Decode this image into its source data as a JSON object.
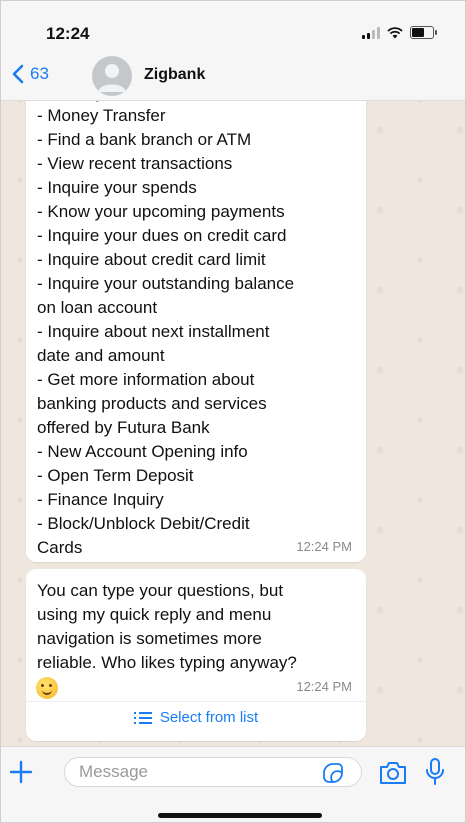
{
  "status_bar": {
    "time": "12:24"
  },
  "header": {
    "back_count": "63",
    "contact_name": "Zigbank"
  },
  "messages": [
    {
      "partial_top_line": "- Bill Payments",
      "lines": [
        "- Money Transfer",
        "- Find a bank branch or ATM",
        "- View recent transactions",
        "- Inquire your spends",
        "- Know your upcoming payments",
        "- Inquire your dues on credit card",
        "- Inquire about credit card limit",
        "- Inquire your outstanding balance",
        "on loan account",
        "- Inquire about next installment",
        "date and amount",
        "- Get more information about",
        "banking products and services",
        "offered by Futura Bank",
        "- New Account Opening info",
        "- Open Term Deposit",
        "- Finance Inquiry",
        "- Block/Unblock Debit/Credit",
        "Cards"
      ],
      "time": "12:24 PM"
    },
    {
      "lines": [
        "You can type your questions, but",
        "using my quick reply and menu",
        "navigation is sometimes more",
        "reliable.  Who likes typing anyway?"
      ],
      "emoji": "smiling-face-icon",
      "time": "12:24 PM",
      "action_label": "Select from list"
    }
  ],
  "input": {
    "placeholder": "Message"
  },
  "colors": {
    "accent": "#1a7cf5",
    "bubble": "#ffffff",
    "chat_bg": "#efe7de",
    "bar_bg": "#f6f6f6"
  }
}
